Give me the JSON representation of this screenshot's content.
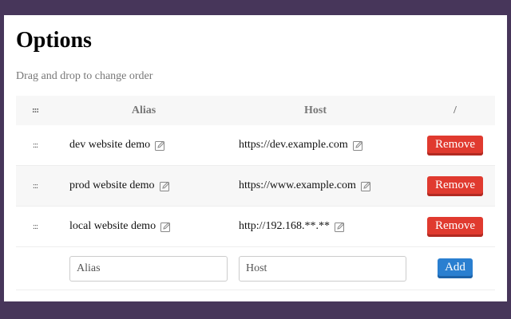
{
  "title": "Options",
  "subtitle": "Drag and drop to change order",
  "table": {
    "headers": {
      "handle": ":::",
      "alias": "Alias",
      "host": "Host",
      "action": "/"
    },
    "rows": [
      {
        "handle": ":::",
        "alias": "dev website demo",
        "host": "https://dev.example.com",
        "action": "Remove"
      },
      {
        "handle": ":::",
        "alias": "prod website demo",
        "host": "https://www.example.com",
        "action": "Remove"
      },
      {
        "handle": ":::",
        "alias": "local website demo",
        "host": "http://192.168.**.**",
        "action": "Remove"
      }
    ],
    "new_row": {
      "alias_placeholder": "Alias",
      "host_placeholder": "Host",
      "add_label": "Add"
    }
  },
  "colors": {
    "background": "#47365a",
    "remove": "#e03a2f",
    "add": "#2a7fd0"
  }
}
